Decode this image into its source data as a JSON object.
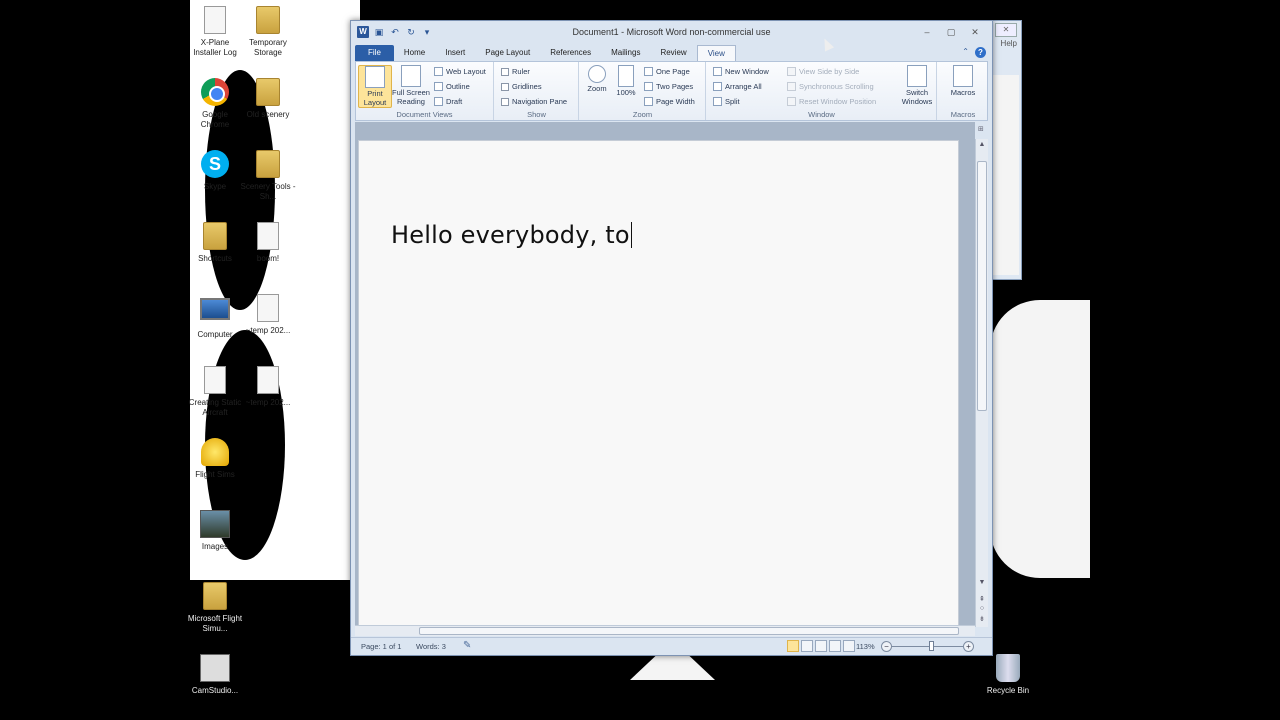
{
  "desktop": {
    "icons": [
      {
        "label": "X-Plane Installer Log",
        "kind": "doc"
      },
      {
        "label": "Temporary Storage",
        "kind": "folder"
      },
      {
        "label": "Google Chrome",
        "kind": "chrome"
      },
      {
        "label": "Old scenery",
        "kind": "folder"
      },
      {
        "label": "Skype",
        "kind": "skype"
      },
      {
        "label": "Scenery Tools - Sh...",
        "kind": "folder"
      },
      {
        "label": "Shortcuts",
        "kind": "folder"
      },
      {
        "label": "boom!",
        "kind": "wav"
      },
      {
        "label": "Computer",
        "kind": "computer"
      },
      {
        "label": "~temp 202...",
        "kind": "avi"
      },
      {
        "label": "Creating Static Aircraft",
        "kind": "doc"
      },
      {
        "label": "~temp 202...",
        "kind": "doc"
      },
      {
        "label": "Flight Sims",
        "kind": "sim"
      },
      {
        "label": "Images",
        "kind": "photo"
      },
      {
        "label": "Microsoft Flight Simu...",
        "kind": "folder"
      },
      {
        "label": "CamStudio...",
        "kind": "cam"
      },
      {
        "label": "Recycle Bin",
        "kind": "bin"
      }
    ],
    "bg_window": {
      "help": "Help"
    }
  },
  "word": {
    "title": "Document1 - Microsoft Word non-commercial use",
    "tabs": [
      "File",
      "Home",
      "Insert",
      "Page Layout",
      "References",
      "Mailings",
      "Review",
      "View"
    ],
    "active_tab": "View",
    "ribbon": {
      "document_views": {
        "label": "Document Views",
        "print_layout": "Print Layout",
        "full_screen": "Full Screen Reading",
        "web_layout": "Web Layout",
        "outline": "Outline",
        "draft": "Draft"
      },
      "show": {
        "label": "Show",
        "ruler": "Ruler",
        "gridlines": "Gridlines",
        "navigation_pane": "Navigation Pane"
      },
      "zoom": {
        "label": "Zoom",
        "zoom": "Zoom",
        "percent": "100%",
        "one_page": "One Page",
        "two_pages": "Two Pages",
        "page_width": "Page Width"
      },
      "window": {
        "label": "Window",
        "new_window": "New Window",
        "arrange_all": "Arrange All",
        "split": "Split",
        "view_side_by_side": "View Side by Side",
        "synchronous_scrolling": "Synchronous Scrolling",
        "reset_window_position": "Reset Window Position",
        "switch_windows": "Switch Windows"
      },
      "macros": {
        "label": "Macros",
        "macros": "Macros"
      }
    },
    "document": {
      "text": "Hello everybody, to"
    },
    "status": {
      "page": "Page: 1 of 1",
      "words": "Words: 3",
      "zoom": "113%",
      "zoom_fraction": 0.53
    }
  }
}
